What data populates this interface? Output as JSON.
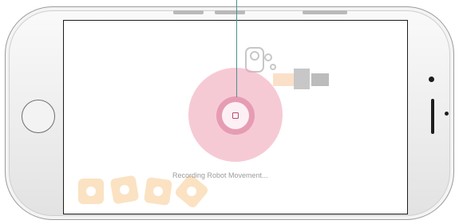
{
  "recording_overlay": {
    "status_text": "Recording Robot Movement...",
    "stop_icon": "stop-square-icon"
  },
  "colors": {
    "halo": "#ee9eb2",
    "ring": "#db809e",
    "stop": "#b54b72",
    "cable": "#4a8f91",
    "block_icons": "#f5b462"
  },
  "icons": {
    "robot": "robot-icon",
    "blocks": "block-icon"
  }
}
